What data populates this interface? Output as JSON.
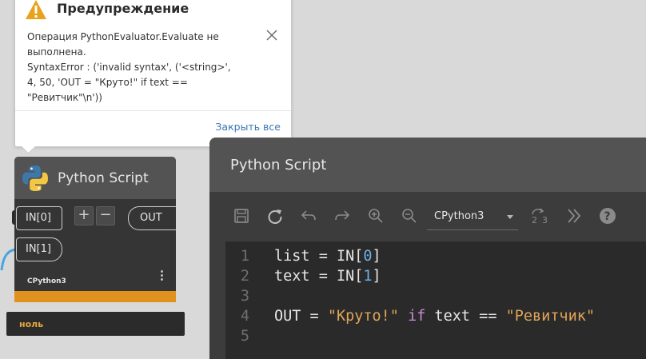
{
  "warning": {
    "title": "Предупреждение",
    "message": "Операция PythonEvaluator.Evaluate не\nвыполнена.\nSyntaxError : ('invalid syntax', ('<string>',\n4, 50, 'OUT = \"Круто!\" if text ==\n\"Ревитчик\"\\n'))",
    "close_all": "Закрыть все",
    "icon_color": "#e8a21c"
  },
  "node": {
    "title": "Python Script",
    "inputs": [
      "IN[0]",
      "IN[1]"
    ],
    "output": "OUT",
    "plus": "+",
    "minus": "−",
    "engine": "CPython3",
    "accent": "#e0921e",
    "preview": "ноль"
  },
  "editor": {
    "title": "Python Script",
    "engine": "CPython3",
    "lines": [
      {
        "n": "1",
        "parts": [
          {
            "t": "list = IN[",
            "c": ""
          },
          {
            "t": "0",
            "c": "num"
          },
          {
            "t": "]",
            "c": ""
          }
        ]
      },
      {
        "n": "2",
        "parts": [
          {
            "t": "text = IN[",
            "c": ""
          },
          {
            "t": "1",
            "c": "num"
          },
          {
            "t": "]",
            "c": ""
          }
        ]
      },
      {
        "n": "3",
        "parts": []
      },
      {
        "n": "4",
        "parts": [
          {
            "t": "OUT = ",
            "c": ""
          },
          {
            "t": "\"Круто!\"",
            "c": "str"
          },
          {
            "t": " ",
            "c": ""
          },
          {
            "t": "if",
            "c": "kw"
          },
          {
            "t": " text == ",
            "c": ""
          },
          {
            "t": "\"Ревитчик\"",
            "c": "str"
          }
        ]
      },
      {
        "n": "5",
        "parts": []
      }
    ]
  }
}
